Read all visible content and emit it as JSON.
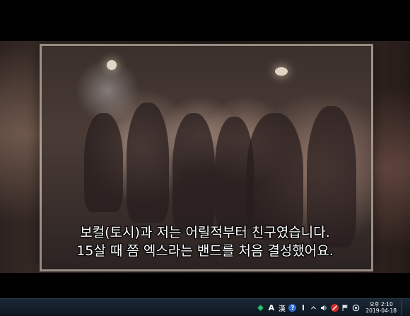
{
  "subtitles": {
    "line1": "보컬(토시)과 저는 어릴적부터 친구였습니다.",
    "line2": "15살 때 쯤 엑스라는 밴드를 처음 결성했어요."
  },
  "taskbar": {
    "tray": {
      "ime_mode": "A",
      "ime_han": "漢",
      "help_label": "?",
      "clock_time": "오후 2:10",
      "clock_date": "2019-04-18"
    },
    "icons": [
      "network-icon",
      "ime-a-icon",
      "ime-hanja-icon",
      "help-icon",
      "input-indicator-icon",
      "chevron-up-icon",
      "volume-icon",
      "block-icon",
      "flag-icon",
      "settings-icon"
    ]
  },
  "colors": {
    "taskbar": "#0d1620",
    "subtitle_text": "#ffffff",
    "help_badge": "#2f6fd0",
    "block_badge": "#d02a2a"
  }
}
